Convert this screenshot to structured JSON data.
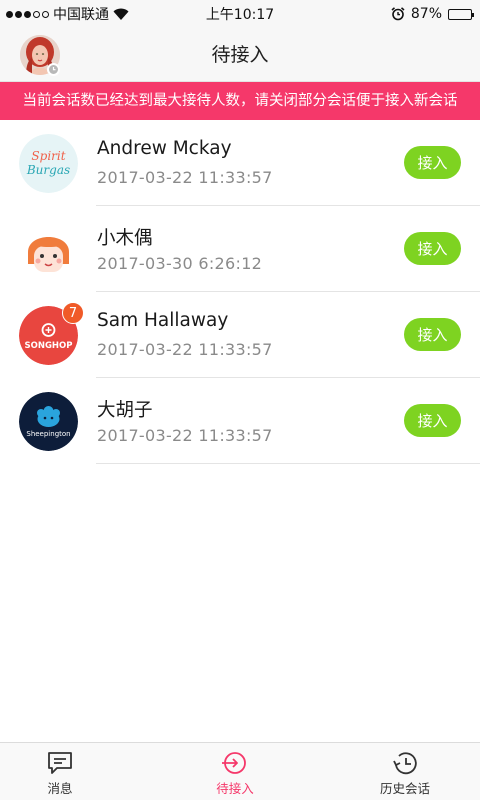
{
  "status_bar": {
    "carrier": "中国联通",
    "time": "上午10:17",
    "battery": "87%",
    "battery_level": 0.87
  },
  "header": {
    "title": "待接入"
  },
  "alert": {
    "text": "当前会话数已经达到最大接待人数，请关闭部分会话便于接入新会话"
  },
  "sessions": [
    {
      "name": "Andrew Mckay",
      "time": "2017-03-22   11:33:57",
      "button": "接入",
      "avatar_text": [
        "Spirit",
        "Burgas"
      ]
    },
    {
      "name": "小木偶",
      "time": "2017-03-30   6:26:12",
      "button": "接入"
    },
    {
      "name": "Sam Hallaway",
      "time": "2017-03-22   11:33:57",
      "button": "接入",
      "badge": "7",
      "avatar_text": "SONGHOP"
    },
    {
      "name": "大胡子",
      "time": "2017-03-22   11:33:57",
      "button": "接入",
      "avatar_text": "Sheepington"
    }
  ],
  "tabs": [
    {
      "label": "消息"
    },
    {
      "label": "待接入"
    },
    {
      "label": "历史会话"
    }
  ],
  "colors": {
    "accent": "#f5386a",
    "accept_button": "#7ed321",
    "badge": "#f05a28"
  }
}
